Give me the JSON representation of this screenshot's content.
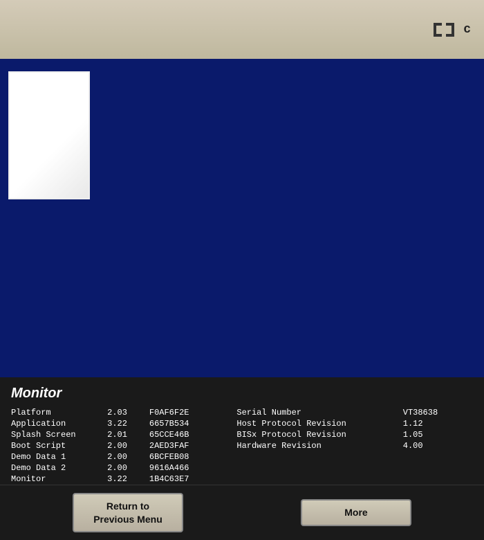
{
  "bezel": {
    "logo_text": "c"
  },
  "monitor_section": {
    "title": "Monitor",
    "rows": [
      {
        "label": "Platform",
        "version": "2.03",
        "hash": "F0AF6F2E"
      },
      {
        "label": "Application",
        "version": "3.22",
        "hash": "6657B534"
      },
      {
        "label": "Splash Screen",
        "version": "2.01",
        "hash": "65CCE46B"
      },
      {
        "label": "Boot Script",
        "version": "2.00",
        "hash": "2AED3FAF"
      },
      {
        "label": "Demo Data 1",
        "version": "2.00",
        "hash": "6BCFEB08"
      },
      {
        "label": "Demo Data 2",
        "version": "2.00",
        "hash": "9616A466"
      },
      {
        "label": "Monitor",
        "version": "3.22",
        "hash": "1B4C63E7"
      }
    ],
    "right_rows": [
      {
        "label": "Serial Number",
        "value": "VT38638"
      },
      {
        "label": "Host Protocol Revision",
        "value": "1.12"
      },
      {
        "label": "BISx Protocol Revision",
        "value": "1.05"
      },
      {
        "label": "Hardware Revision",
        "value": "4.00"
      }
    ]
  },
  "buttons": {
    "return_label": "Return to\nPrevious Menu",
    "more_label": "More"
  }
}
